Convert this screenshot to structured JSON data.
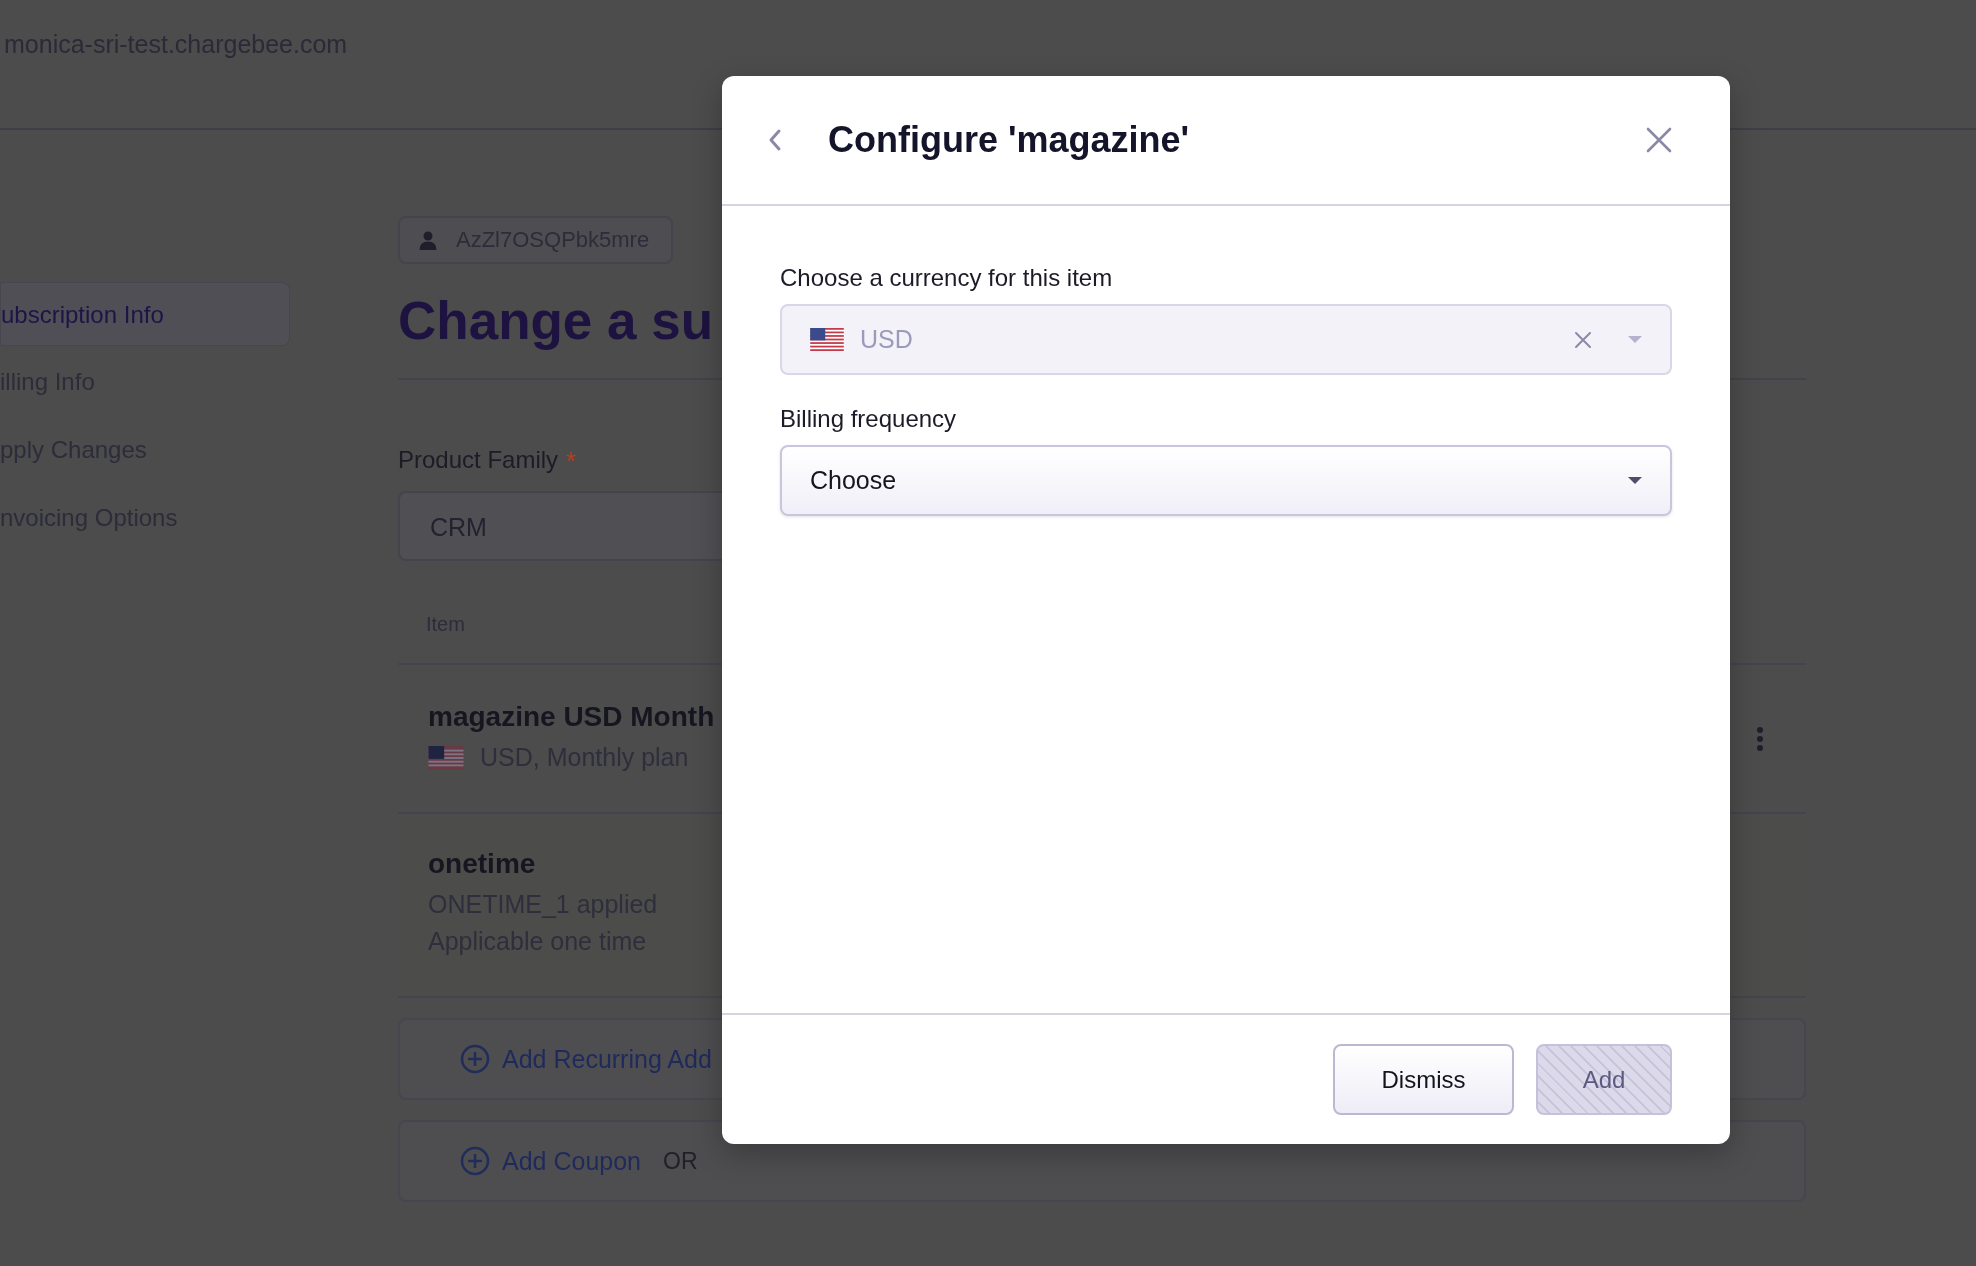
{
  "header": {
    "url": "monica-sri-test.chargebee.com"
  },
  "sidebar": {
    "items": [
      {
        "label": "ubscription Info",
        "selected": true
      },
      {
        "label": "illing Info",
        "selected": false
      },
      {
        "label": "pply Changes",
        "selected": false
      },
      {
        "label": "nvoicing Options",
        "selected": false
      }
    ]
  },
  "customer_chip": {
    "label": "AzZl7OSQPbk5mre"
  },
  "page_title": "Change a su",
  "product_family": {
    "label": "Product Family",
    "required_mark": "*",
    "value": "CRM"
  },
  "items_table": {
    "column_1": "Item",
    "rows": [
      {
        "kind": "plan",
        "title": "magazine USD Month",
        "lines": [
          "USD, Monthly plan"
        ]
      },
      {
        "kind": "charge",
        "title": "onetime",
        "lines": [
          "ONETIME_1 applied",
          "Applicable one time"
        ]
      }
    ]
  },
  "actions": [
    {
      "label": "Add Recurring Add"
    },
    {
      "label": "Add Coupon",
      "separator": "OR"
    }
  ],
  "modal": {
    "title": "Configure 'magazine'",
    "fields": [
      {
        "label": "Choose a currency for this item",
        "value": "USD",
        "flag": true,
        "clearable": true,
        "disabled": true
      },
      {
        "label": "Billing frequency",
        "value": "Choose",
        "flag": false,
        "clearable": false,
        "disabled": false
      }
    ],
    "buttons": [
      {
        "label": "Dismiss",
        "kind": "secondary",
        "disabled": false
      },
      {
        "label": "Add",
        "kind": "primary",
        "disabled": true
      }
    ]
  }
}
